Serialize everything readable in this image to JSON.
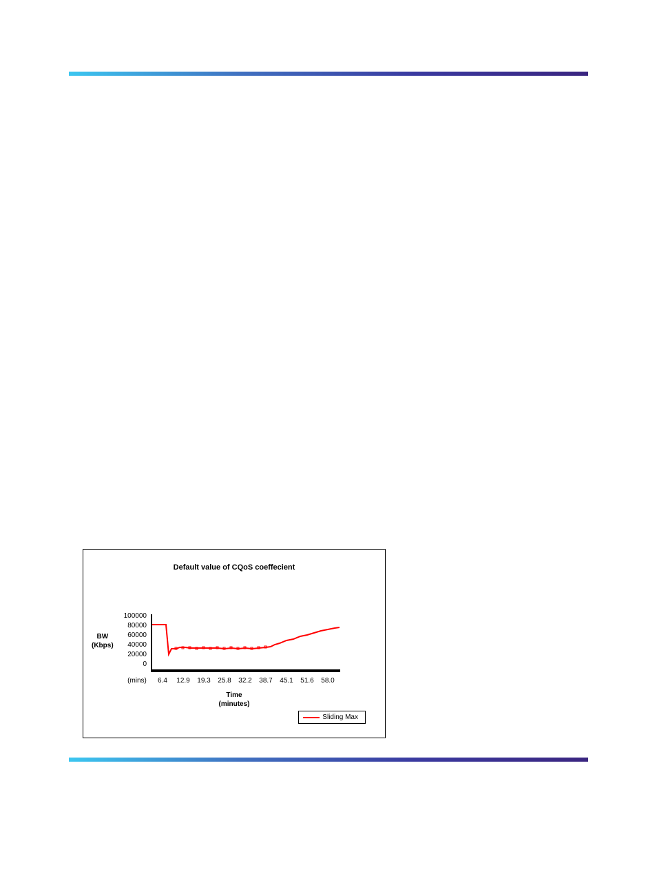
{
  "chart_data": {
    "type": "line",
    "title": "Default value of CQoS coeffecient",
    "ylabel_line1": "BW",
    "ylabel_line2": "(Kbps)",
    "xlabel_line1": "Time",
    "xlabel_line2": "(minutes)",
    "x_unit_label": "(mins)",
    "y_ticks": [
      "100000",
      "80000",
      "60000",
      "40000",
      "20000",
      "0"
    ],
    "x_ticks": [
      "6.4",
      "12.9",
      "19.3",
      "25.8",
      "32.2",
      "38.7",
      "45.1",
      "51.6",
      "58.0"
    ],
    "ylim": [
      0,
      100000
    ],
    "series": [
      {
        "name": "Sliding Max",
        "x": [
          0,
          3,
          5,
          6,
          7,
          8,
          10,
          12,
          15,
          18,
          20,
          25,
          30,
          35,
          38,
          40,
          42,
          44,
          46,
          48,
          50,
          52,
          54,
          56,
          58
        ],
        "values": [
          82000,
          82000,
          82000,
          30000,
          40000,
          40000,
          40000,
          42000,
          42000,
          42000,
          42000,
          42000,
          42000,
          42000,
          44000,
          50000,
          55000,
          58000,
          62000,
          66000,
          70000,
          72000,
          74000,
          76000,
          78000
        ]
      }
    ]
  },
  "legend": {
    "series1": "Sliding Max"
  }
}
